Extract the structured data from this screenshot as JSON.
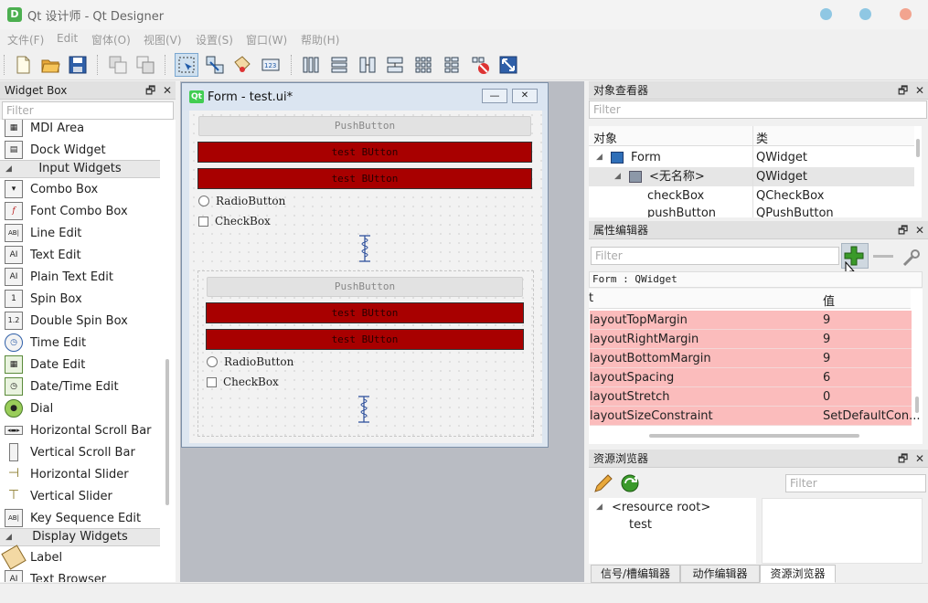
{
  "window": {
    "title": "Qt 设计师 - Qt Designer",
    "app_icon_letter": "D",
    "controls_colors": [
      "#8fc7e3",
      "#8fc7e3",
      "#f2a48f"
    ]
  },
  "menu": [
    "文件(F)",
    "Edit",
    "窗体(O)",
    "视图(V)",
    "设置(S)",
    "窗口(W)",
    "帮助(H)"
  ],
  "toolbar": {
    "icons": [
      "new-file-icon",
      "open-folder-icon",
      "save-icon",
      "copy-icon",
      "paste-icon",
      "edit-widgets-icon",
      "edit-signals-slots-icon",
      "edit-buddies-icon",
      "edit-tab-order-icon",
      "layout-horizontal-icon",
      "layout-vertical-icon",
      "layout-horizontal-splitter-icon",
      "layout-vertical-splitter-icon",
      "layout-grid-icon",
      "layout-form-icon",
      "break-layout-icon",
      "adjust-size-icon"
    ]
  },
  "widget_box": {
    "title": "Widget Box",
    "filter_placeholder": "Filter",
    "items": [
      {
        "label": "MDI Area",
        "icon": "mdi-area-icon"
      },
      {
        "label": "Dock Widget",
        "icon": "dock-widget-icon"
      },
      {
        "category": "Input Widgets"
      },
      {
        "label": "Combo Box",
        "icon": "combo-box-icon"
      },
      {
        "label": "Font Combo Box",
        "icon": "font-combo-box-icon",
        "glyph": "f"
      },
      {
        "label": "Line Edit",
        "icon": "line-edit-icon",
        "glyph": "AB|"
      },
      {
        "label": "Text Edit",
        "icon": "text-edit-icon",
        "glyph": "AI"
      },
      {
        "label": "Plain Text Edit",
        "icon": "plain-text-edit-icon",
        "glyph": "AI"
      },
      {
        "label": "Spin Box",
        "icon": "spin-box-icon",
        "glyph": "1"
      },
      {
        "label": "Double Spin Box",
        "icon": "double-spin-box-icon",
        "glyph": "1.2"
      },
      {
        "label": "Time Edit",
        "icon": "time-edit-icon"
      },
      {
        "label": "Date Edit",
        "icon": "date-edit-icon"
      },
      {
        "label": "Date/Time Edit",
        "icon": "date-time-edit-icon"
      },
      {
        "label": "Dial",
        "icon": "dial-icon"
      },
      {
        "label": "Horizontal Scroll Bar",
        "icon": "horizontal-scroll-bar-icon"
      },
      {
        "label": "Vertical Scroll Bar",
        "icon": "vertical-scroll-bar-icon"
      },
      {
        "label": "Horizontal Slider",
        "icon": "horizontal-slider-icon"
      },
      {
        "label": "Vertical Slider",
        "icon": "vertical-slider-icon"
      },
      {
        "label": "Key Sequence Edit",
        "icon": "key-sequence-edit-icon",
        "glyph": "AB|"
      },
      {
        "category": "Display Widgets"
      },
      {
        "label": "Label",
        "icon": "label-icon"
      },
      {
        "label": "Text Browser",
        "icon": "text-browser-icon",
        "glyph": "AI"
      }
    ]
  },
  "form_window": {
    "title": "Form - test.ui*",
    "icon_text": "Qt",
    "group1": {
      "push": "PushButton",
      "red1": "test BUtton",
      "red2": "test BUtton",
      "radio": "RadioButton",
      "check": "CheckBox"
    },
    "group2": {
      "push": "PushButton",
      "red1": "test BUtton",
      "red2": "test BUtton",
      "radio": "RadioButton",
      "check": "CheckBox"
    }
  },
  "object_inspector": {
    "title": "对象查看器",
    "filter_placeholder": "Filter",
    "col_object": "对象",
    "col_class": "类",
    "rows": [
      {
        "object": "Form",
        "class": "QWidget"
      },
      {
        "object": "<无名称>",
        "class": "QWidget"
      },
      {
        "object": "checkBox",
        "class": "QCheckBox"
      },
      {
        "object": "pushButton",
        "class": "QPushButton"
      }
    ]
  },
  "property_editor": {
    "title": "属性编辑器",
    "filter_placeholder": "Filter",
    "context": "Form : QWidget",
    "col_property": "t",
    "col_value": "值",
    "rows": [
      {
        "name": "layoutTopMargin",
        "value": "9"
      },
      {
        "name": "layoutRightMargin",
        "value": "9"
      },
      {
        "name": "layoutBottomMargin",
        "value": "9"
      },
      {
        "name": "layoutSpacing",
        "value": "6"
      },
      {
        "name": "layoutStretch",
        "value": "0"
      },
      {
        "name": "layoutSizeConstraint",
        "value": "SetDefaultCon..."
      }
    ]
  },
  "resource_browser": {
    "title": "资源浏览器",
    "filter_placeholder": "Filter",
    "root": "<resource root>",
    "child": "test"
  },
  "bottom_tabs": [
    "信号/槽编辑器",
    "动作编辑器",
    "资源浏览器"
  ]
}
